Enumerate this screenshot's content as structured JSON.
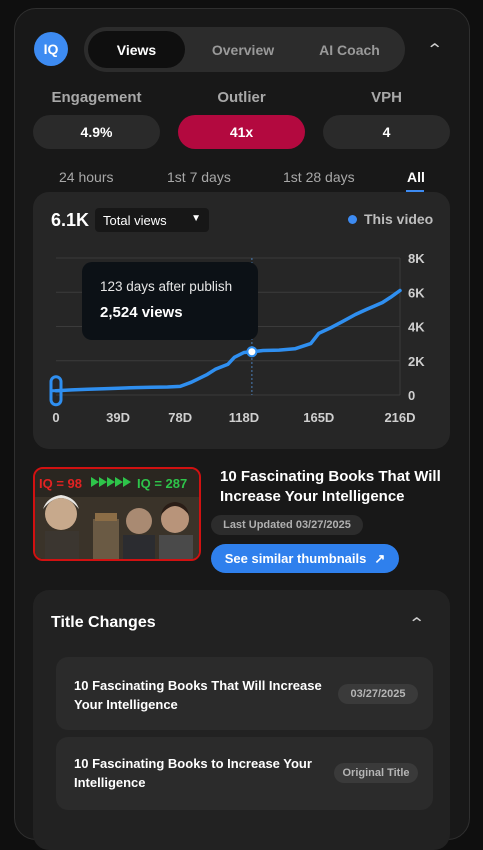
{
  "header": {
    "logo_text": "IQ",
    "tabs": [
      {
        "label": "Views",
        "active": true
      },
      {
        "label": "Overview",
        "active": false
      },
      {
        "label": "AI Coach",
        "active": false
      }
    ],
    "collapse_icon": "chevron-up-icon"
  },
  "stats": [
    {
      "label": "Engagement",
      "value": "4.9%"
    },
    {
      "label": "Outlier",
      "value": "41x",
      "color": "#b3093f"
    },
    {
      "label": "VPH",
      "value": "4"
    }
  ],
  "ranges": [
    {
      "label": "24 hours",
      "active": false
    },
    {
      "label": "1st 7 days",
      "active": false
    },
    {
      "label": "1st 28 days",
      "active": false
    },
    {
      "label": "All",
      "active": true
    }
  ],
  "chart_header": {
    "value": "6.1K",
    "metric_select": "Total views",
    "legend": "This video"
  },
  "chart_data": {
    "type": "line",
    "series": [
      {
        "name": "This video",
        "color": "#2f8ff0",
        "x": [
          0,
          10,
          20,
          30,
          39,
          50,
          60,
          70,
          78,
          85,
          95,
          100,
          108,
          112,
          118,
          123,
          130,
          140,
          150,
          160,
          165,
          172,
          180,
          188,
          195,
          200,
          205,
          210,
          216
        ],
        "y": [
          250,
          300,
          340,
          370,
          400,
          430,
          450,
          470,
          500,
          750,
          1200,
          1500,
          1800,
          2200,
          2480,
          2524,
          2600,
          2620,
          2700,
          3000,
          3600,
          3900,
          4300,
          4700,
          5000,
          5200,
          5400,
          5700,
          6100
        ]
      }
    ],
    "xticks": [
      "0",
      "39D",
      "78D",
      "118D",
      "165D",
      "216D"
    ],
    "yticks": [
      "0",
      "2K",
      "4K",
      "6K",
      "8K"
    ],
    "xlim": [
      0,
      216
    ],
    "ylim": [
      0,
      8000
    ],
    "grid": true,
    "highlight": {
      "x": 123,
      "y": 2524
    }
  },
  "tooltip": {
    "line1": "123 days after publish",
    "line2": "2,524 views"
  },
  "video": {
    "thumbnail_text_left": "IQ = 98",
    "thumbnail_text_right": "IQ = 287",
    "title": "10 Fascinating Books That Will Increase Your Intelligence",
    "updated": "Last Updated 03/27/2025",
    "similar_button": "See similar thumbnails"
  },
  "title_changes": {
    "heading": "Title Changes",
    "items": [
      {
        "title": "10 Fascinating Books That Will Increase Your Intelligence",
        "badge": "03/27/2025"
      },
      {
        "title": "10 Fascinating Books to Increase Your Intelligence",
        "badge": "Original Title"
      }
    ]
  }
}
